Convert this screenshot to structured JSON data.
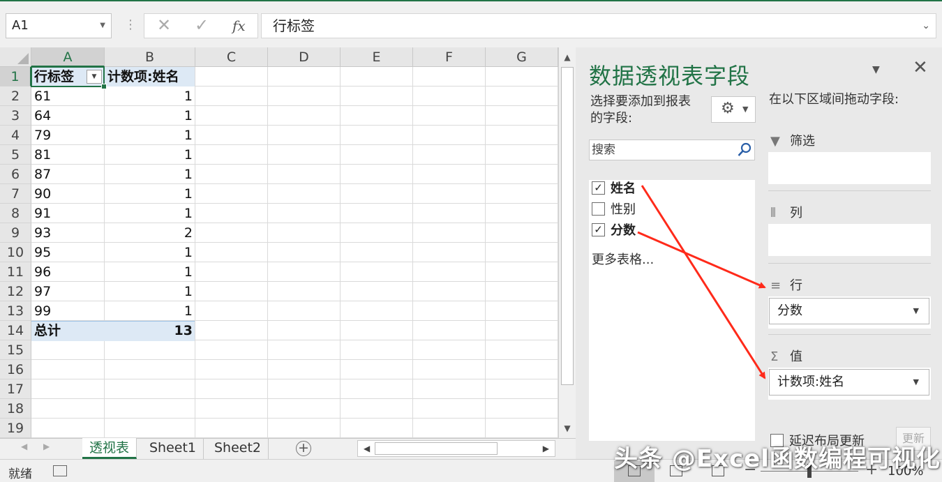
{
  "formula_bar": {
    "name_box": "A1",
    "cancel_glyph": "✕",
    "enter_glyph": "✓",
    "fx_label": "fx",
    "formula": "行标签"
  },
  "columns": [
    "A",
    "B",
    "C",
    "D",
    "E",
    "F",
    "G"
  ],
  "rows": [
    "1",
    "2",
    "3",
    "4",
    "5",
    "6",
    "7",
    "8",
    "9",
    "10",
    "11",
    "12",
    "13",
    "14",
    "15",
    "16",
    "17",
    "18",
    "19"
  ],
  "pivot_table": {
    "header": [
      "行标签",
      "计数项:姓名"
    ],
    "rows": [
      {
        "label": "61",
        "count": "1"
      },
      {
        "label": "64",
        "count": "1"
      },
      {
        "label": "79",
        "count": "1"
      },
      {
        "label": "81",
        "count": "1"
      },
      {
        "label": "87",
        "count": "1"
      },
      {
        "label": "90",
        "count": "1"
      },
      {
        "label": "91",
        "count": "1"
      },
      {
        "label": "93",
        "count": "2"
      },
      {
        "label": "95",
        "count": "1"
      },
      {
        "label": "96",
        "count": "1"
      },
      {
        "label": "97",
        "count": "1"
      },
      {
        "label": "99",
        "count": "1"
      }
    ],
    "total": {
      "label": "总计",
      "count": "13"
    }
  },
  "sheet_tabs": [
    {
      "label": "透视表",
      "active": true
    },
    {
      "label": "Sheet1",
      "active": false
    },
    {
      "label": "Sheet2",
      "active": false
    }
  ],
  "status_bar": {
    "ready": "就绪",
    "zoom": "100%"
  },
  "pivot_pane": {
    "title": "数据透视表字段",
    "choose_fields_label": "选择要添加到报表的字段:",
    "search_placeholder": "搜索",
    "fields": [
      {
        "label": "姓名",
        "checked": true
      },
      {
        "label": "性别",
        "checked": false
      },
      {
        "label": "分数",
        "checked": true
      }
    ],
    "more_tables": "更多表格...",
    "drag_label": "在以下区域间拖动字段:",
    "areas": {
      "filters": {
        "label": "筛选",
        "items": []
      },
      "columns": {
        "label": "列",
        "items": []
      },
      "rows": {
        "label": "行",
        "items": [
          "分数"
        ]
      },
      "values": {
        "label": "值",
        "items": [
          "计数项:姓名"
        ]
      }
    },
    "defer_label": "延迟布局更新",
    "update_button": "更新"
  },
  "annotation_color": "#ff2a1a",
  "accent_color": "#217346",
  "watermark": "头条 @Excel函数编程可视化"
}
